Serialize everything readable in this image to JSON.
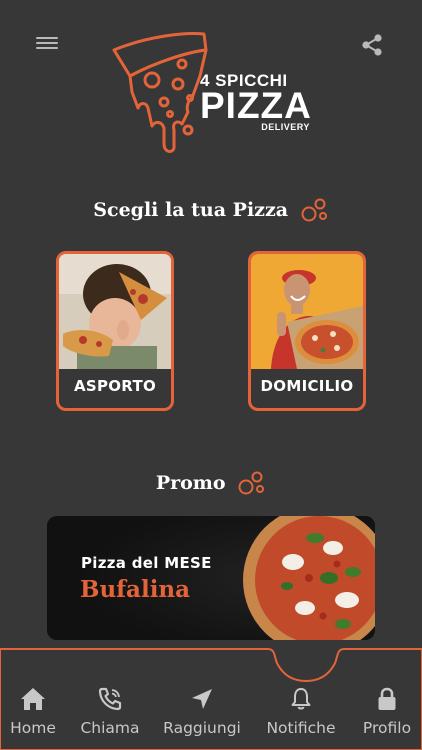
{
  "header": {
    "logo_line1": "4 SPICCHI",
    "logo_line2": "PIZZA",
    "logo_line3": "DELIVERY",
    "menu_icon": "hamburger-menu-icon",
    "share_icon": "share-icon"
  },
  "choose_section": {
    "title": "Scegli la tua Pizza",
    "cards": [
      {
        "label": "ASPORTO"
      },
      {
        "label": "DOMICILIO"
      }
    ]
  },
  "promo_section": {
    "title": "Promo",
    "banner": {
      "subtitle": "Pizza del MESE",
      "name": "Bufalina"
    }
  },
  "bottom_nav": {
    "items": [
      {
        "label": "Home",
        "icon": "home-icon"
      },
      {
        "label": "Chiama",
        "icon": "phone-icon"
      },
      {
        "label": "Raggiungi",
        "icon": "navigation-arrow-icon"
      },
      {
        "label": "Notifiche",
        "icon": "bell-icon"
      },
      {
        "label": "Profilo",
        "icon": "lock-icon"
      }
    ]
  },
  "colors": {
    "background": "#373737",
    "accent": "#e4643a",
    "promo_bg": "#151515",
    "nav_text": "#c8c8c8"
  }
}
